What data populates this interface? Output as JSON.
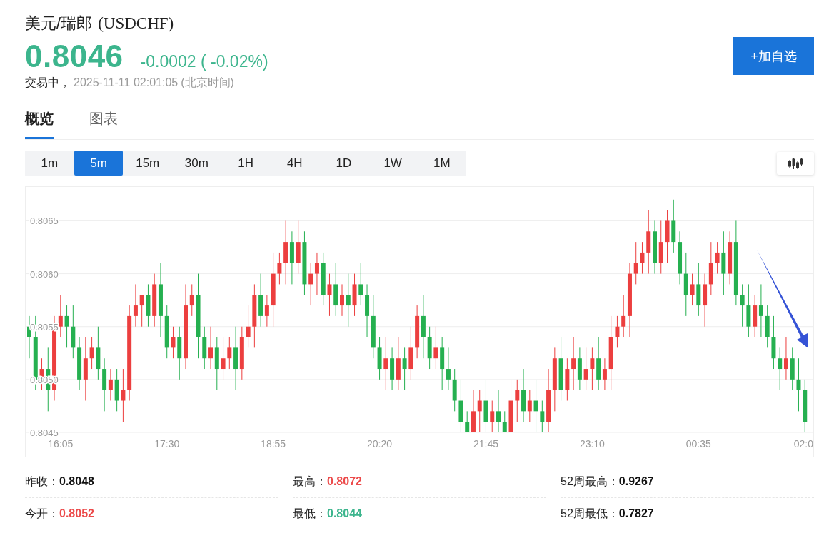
{
  "header": {
    "name": "美元/瑞郎",
    "symbol": "(USDCHF)",
    "price": "0.8046",
    "change": "-0.0002 ( -0.02%)",
    "status": "交易中，",
    "timestamp": "2025-11-11 02:01:05",
    "timezone": "(北京时间)",
    "add_button": "+加自选"
  },
  "tabs": [
    {
      "label": "概览",
      "selected": true
    },
    {
      "label": "图表",
      "selected": false
    }
  ],
  "intervals": [
    {
      "label": "1m",
      "selected": false
    },
    {
      "label": "5m",
      "selected": true
    },
    {
      "label": "15m",
      "selected": false
    },
    {
      "label": "30m",
      "selected": false
    },
    {
      "label": "1H",
      "selected": false
    },
    {
      "label": "4H",
      "selected": false
    },
    {
      "label": "1D",
      "selected": false
    },
    {
      "label": "1W",
      "selected": false
    },
    {
      "label": "1M",
      "selected": false
    }
  ],
  "chart": {
    "chart_data": {
      "type": "candlestick",
      "grid": true,
      "categories": [
        null,
        null,
        null,
        null,
        null,
        "16:05",
        null,
        null,
        null,
        null,
        null,
        null,
        null,
        null,
        null,
        null,
        null,
        null,
        null,
        null,
        null,
        null,
        "17:30",
        null,
        null,
        null,
        null,
        null,
        null,
        null,
        null,
        null,
        null,
        null,
        null,
        null,
        null,
        null,
        null,
        "18:55",
        null,
        null,
        null,
        null,
        null,
        null,
        null,
        null,
        null,
        null,
        null,
        null,
        null,
        null,
        null,
        null,
        "20:20",
        null,
        null,
        null,
        null,
        null,
        null,
        null,
        null,
        null,
        null,
        null,
        null,
        null,
        null,
        null,
        null,
        "21:45",
        null,
        null,
        null,
        null,
        null,
        null,
        null,
        null,
        null,
        null,
        null,
        null,
        null,
        null,
        null,
        null,
        "23:10",
        null,
        null,
        null,
        null,
        null,
        null,
        null,
        null,
        null,
        null,
        null,
        null,
        null,
        null,
        null,
        null,
        "00:35",
        null,
        null,
        null,
        null,
        null,
        null,
        null,
        null,
        null,
        null,
        null,
        null,
        null,
        null,
        null,
        null,
        "02:0"
      ],
      "ohlc": [
        [
          0.8055,
          0.8056,
          0.8052,
          0.8054
        ],
        [
          0.8054,
          0.8056,
          0.8049,
          0.805
        ],
        [
          0.805,
          0.8052,
          0.8049,
          0.8051
        ],
        [
          0.8051,
          0.8053,
          0.8047,
          0.8049
        ],
        [
          0.8049,
          0.8056,
          0.8048,
          0.8055
        ],
        [
          0.8055,
          0.8058,
          0.8054,
          0.8056
        ],
        [
          0.8056,
          0.8057,
          0.8053,
          0.8055
        ],
        [
          0.8055,
          0.8057,
          0.8052,
          0.8053
        ],
        [
          0.8053,
          0.8054,
          0.8049,
          0.805
        ],
        [
          0.805,
          0.8054,
          0.8048,
          0.8052
        ],
        [
          0.8052,
          0.8054,
          0.8051,
          0.8053
        ],
        [
          0.8053,
          0.8055,
          0.805,
          0.8051
        ],
        [
          0.8051,
          0.8052,
          0.8047,
          0.8049
        ],
        [
          0.8049,
          0.8051,
          0.8048,
          0.805
        ],
        [
          0.805,
          0.8051,
          0.8047,
          0.8048
        ],
        [
          0.8048,
          0.8051,
          0.8046,
          0.8049
        ],
        [
          0.8049,
          0.8057,
          0.8048,
          0.8056
        ],
        [
          0.8056,
          0.8059,
          0.8055,
          0.8057
        ],
        [
          0.8057,
          0.8058,
          0.8055,
          0.8058
        ],
        [
          0.8058,
          0.8059,
          0.8055,
          0.8056
        ],
        [
          0.8056,
          0.806,
          0.8055,
          0.8059
        ],
        [
          0.8059,
          0.8061,
          0.8054,
          0.8056
        ],
        [
          0.8056,
          0.8057,
          0.8052,
          0.8053
        ],
        [
          0.8053,
          0.8055,
          0.8052,
          0.8054
        ],
        [
          0.8054,
          0.8055,
          0.805,
          0.8052
        ],
        [
          0.8052,
          0.8059,
          0.8051,
          0.8057
        ],
        [
          0.8057,
          0.8059,
          0.8056,
          0.8058
        ],
        [
          0.8058,
          0.806,
          0.8052,
          0.8054
        ],
        [
          0.8054,
          0.8055,
          0.8051,
          0.8052
        ],
        [
          0.8052,
          0.8055,
          0.8051,
          0.8053
        ],
        [
          0.8053,
          0.8054,
          0.8049,
          0.8051
        ],
        [
          0.8051,
          0.8054,
          0.805,
          0.8052
        ],
        [
          0.8052,
          0.8054,
          0.8051,
          0.8053
        ],
        [
          0.8053,
          0.8055,
          0.8049,
          0.8051
        ],
        [
          0.8051,
          0.8055,
          0.805,
          0.8054
        ],
        [
          0.8054,
          0.8057,
          0.8053,
          0.8055
        ],
        [
          0.8055,
          0.8059,
          0.8053,
          0.8058
        ],
        [
          0.8058,
          0.806,
          0.8055,
          0.8056
        ],
        [
          0.8056,
          0.8058,
          0.8055,
          0.8057
        ],
        [
          0.8057,
          0.8062,
          0.8055,
          0.806
        ],
        [
          0.806,
          0.8062,
          0.8059,
          0.8061
        ],
        [
          0.8061,
          0.8065,
          0.8059,
          0.8063
        ],
        [
          0.8063,
          0.8064,
          0.8059,
          0.8061
        ],
        [
          0.8061,
          0.8065,
          0.806,
          0.8063
        ],
        [
          0.8063,
          0.8064,
          0.8058,
          0.8059
        ],
        [
          0.8059,
          0.8061,
          0.8057,
          0.806
        ],
        [
          0.806,
          0.8062,
          0.8058,
          0.8061
        ],
        [
          0.8061,
          0.8062,
          0.8057,
          0.8058
        ],
        [
          0.8058,
          0.806,
          0.8056,
          0.8059
        ],
        [
          0.8059,
          0.8061,
          0.8056,
          0.8057
        ],
        [
          0.8057,
          0.8059,
          0.8056,
          0.8058
        ],
        [
          0.8058,
          0.806,
          0.8055,
          0.8057
        ],
        [
          0.8057,
          0.806,
          0.8056,
          0.8059
        ],
        [
          0.8059,
          0.8061,
          0.8057,
          0.8058
        ],
        [
          0.8058,
          0.8059,
          0.8054,
          0.8056
        ],
        [
          0.8056,
          0.8058,
          0.8052,
          0.8053
        ],
        [
          0.8053,
          0.8054,
          0.805,
          0.8051
        ],
        [
          0.8051,
          0.8054,
          0.8049,
          0.8052
        ],
        [
          0.8052,
          0.8053,
          0.8049,
          0.805
        ],
        [
          0.805,
          0.8054,
          0.8049,
          0.8052
        ],
        [
          0.8052,
          0.8053,
          0.8049,
          0.8051
        ],
        [
          0.8051,
          0.8055,
          0.805,
          0.8053
        ],
        [
          0.8053,
          0.8057,
          0.8052,
          0.8056
        ],
        [
          0.8056,
          0.8058,
          0.8052,
          0.8054
        ],
        [
          0.8054,
          0.8055,
          0.8051,
          0.8052
        ],
        [
          0.8052,
          0.8055,
          0.8051,
          0.8053
        ],
        [
          0.8053,
          0.8054,
          0.8049,
          0.8051
        ],
        [
          0.8051,
          0.8053,
          0.8049,
          0.805
        ],
        [
          0.805,
          0.8051,
          0.8047,
          0.8048
        ],
        [
          0.8048,
          0.805,
          0.8045,
          0.8046
        ],
        [
          0.8046,
          0.8047,
          0.8045,
          0.8045
        ],
        [
          0.8045,
          0.8049,
          0.8045,
          0.8047
        ],
        [
          0.8047,
          0.8049,
          0.8045,
          0.8048
        ],
        [
          0.8048,
          0.805,
          0.8045,
          0.8046
        ],
        [
          0.8046,
          0.8048,
          0.8045,
          0.8047
        ],
        [
          0.8047,
          0.8049,
          0.8045,
          0.8046
        ],
        [
          0.8046,
          0.8047,
          0.8045,
          0.8045
        ],
        [
          0.8045,
          0.805,
          0.8045,
          0.8048
        ],
        [
          0.8048,
          0.805,
          0.8046,
          0.8049
        ],
        [
          0.8049,
          0.8051,
          0.8046,
          0.8047
        ],
        [
          0.8047,
          0.8049,
          0.8046,
          0.8048
        ],
        [
          0.8048,
          0.805,
          0.8045,
          0.8047
        ],
        [
          0.8047,
          0.8048,
          0.8045,
          0.8046
        ],
        [
          0.8046,
          0.8051,
          0.8045,
          0.8049
        ],
        [
          0.8049,
          0.8053,
          0.8047,
          0.8052
        ],
        [
          0.8052,
          0.8054,
          0.8048,
          0.8049
        ],
        [
          0.8049,
          0.8052,
          0.8048,
          0.8051
        ],
        [
          0.8051,
          0.8054,
          0.8049,
          0.8052
        ],
        [
          0.8052,
          0.8053,
          0.8049,
          0.805
        ],
        [
          0.805,
          0.8053,
          0.8049,
          0.8051
        ],
        [
          0.8051,
          0.8053,
          0.8049,
          0.8052
        ],
        [
          0.8052,
          0.8054,
          0.8049,
          0.805
        ],
        [
          0.805,
          0.8052,
          0.8049,
          0.8051
        ],
        [
          0.8051,
          0.8056,
          0.8049,
          0.8054
        ],
        [
          0.8054,
          0.8056,
          0.8053,
          0.8055
        ],
        [
          0.8055,
          0.8058,
          0.8054,
          0.8056
        ],
        [
          0.8056,
          0.8061,
          0.8054,
          0.806
        ],
        [
          0.806,
          0.8063,
          0.8059,
          0.8061
        ],
        [
          0.8061,
          0.8063,
          0.806,
          0.8062
        ],
        [
          0.8062,
          0.8066,
          0.806,
          0.8064
        ],
        [
          0.8064,
          0.8065,
          0.806,
          0.8061
        ],
        [
          0.8061,
          0.8065,
          0.806,
          0.8063
        ],
        [
          0.8063,
          0.8066,
          0.8061,
          0.8065
        ],
        [
          0.8065,
          0.8067,
          0.8062,
          0.8063
        ],
        [
          0.8063,
          0.8064,
          0.8059,
          0.806
        ],
        [
          0.806,
          0.8062,
          0.8056,
          0.8058
        ],
        [
          0.8058,
          0.806,
          0.8057,
          0.8059
        ],
        [
          0.8059,
          0.8061,
          0.8056,
          0.8057
        ],
        [
          0.8057,
          0.806,
          0.8055,
          0.8059
        ],
        [
          0.8059,
          0.8063,
          0.8058,
          0.8061
        ],
        [
          0.8061,
          0.8063,
          0.806,
          0.8062
        ],
        [
          0.8062,
          0.8064,
          0.8058,
          0.806
        ],
        [
          0.806,
          0.8064,
          0.8059,
          0.8063
        ],
        [
          0.8063,
          0.8065,
          0.8057,
          0.8058
        ],
        [
          0.8058,
          0.8059,
          0.8055,
          0.8057
        ],
        [
          0.8057,
          0.8059,
          0.8054,
          0.8055
        ],
        [
          0.8055,
          0.8058,
          0.8054,
          0.8057
        ],
        [
          0.8057,
          0.8059,
          0.8054,
          0.8056
        ],
        [
          0.8056,
          0.8057,
          0.8053,
          0.8054
        ],
        [
          0.8054,
          0.8056,
          0.8051,
          0.8052
        ],
        [
          0.8052,
          0.8053,
          0.8049,
          0.8051
        ],
        [
          0.8051,
          0.8054,
          0.805,
          0.8052
        ],
        [
          0.8052,
          0.8053,
          0.8049,
          0.805
        ],
        [
          0.805,
          0.8052,
          0.8047,
          0.8049
        ],
        [
          0.8049,
          0.805,
          0.8045,
          0.8046
        ]
      ],
      "ylim": [
        0.8045,
        0.80682
      ],
      "yticks": [
        {
          "value": 0.8065,
          "label": "0.8065"
        },
        {
          "value": 0.806,
          "label": "0.8060"
        },
        {
          "value": 0.8055,
          "label": "0.8055"
        },
        {
          "value": 0.805,
          "label": "0.8050"
        },
        {
          "value": 0.8045,
          "label": "0.8045"
        }
      ]
    }
  },
  "stats": [
    {
      "label": "昨收：",
      "value": "0.8048",
      "kind": "flat"
    },
    {
      "label": "最高：",
      "value": "0.8072",
      "kind": "up"
    },
    {
      "label": "52周最高：",
      "value": "0.9267",
      "kind": "flat"
    },
    {
      "label": "今开：",
      "value": "0.8052",
      "kind": "up"
    },
    {
      "label": "最低：",
      "value": "0.8044",
      "kind": "down"
    },
    {
      "label": "52周最低：",
      "value": "0.7827",
      "kind": "flat"
    }
  ]
}
